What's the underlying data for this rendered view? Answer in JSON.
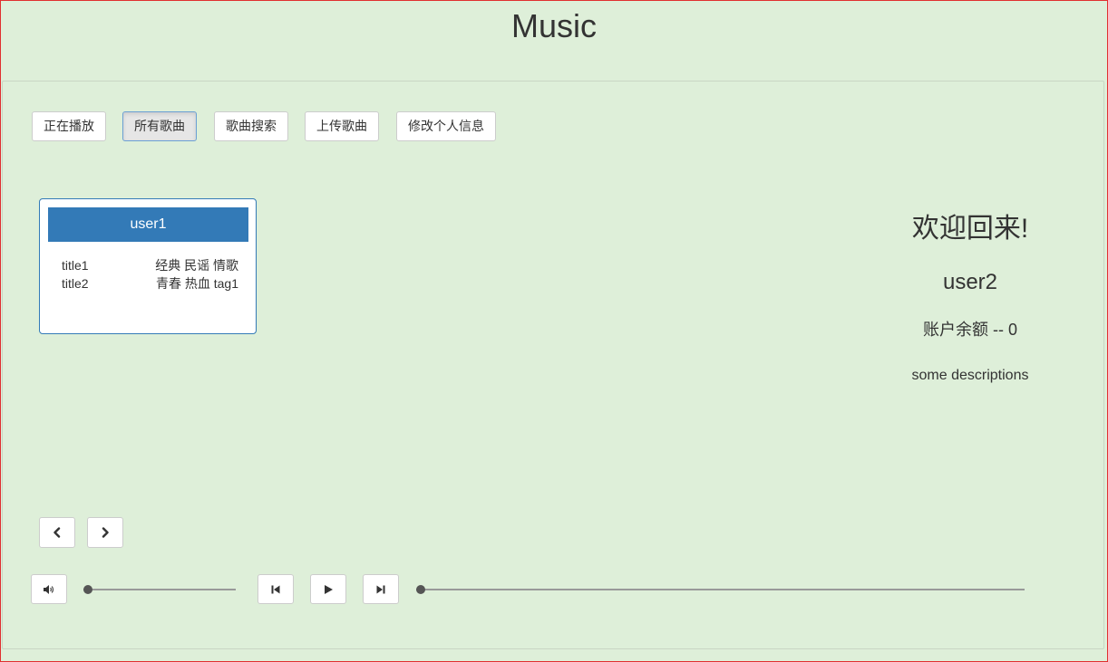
{
  "app": {
    "title": "Music"
  },
  "nav": {
    "buttons": [
      {
        "label": "正在播放",
        "active": false
      },
      {
        "label": "所有歌曲",
        "active": true
      },
      {
        "label": "歌曲搜索",
        "active": false
      },
      {
        "label": "上传歌曲",
        "active": false
      },
      {
        "label": "修改个人信息",
        "active": false
      }
    ]
  },
  "user_card": {
    "username": "user1",
    "songs": [
      {
        "title": "title1",
        "tags": "经典 民谣 情歌"
      },
      {
        "title": "title2",
        "tags": "青春 热血 tag1"
      }
    ]
  },
  "welcome": {
    "heading": "欢迎回来!",
    "username": "user2",
    "balance": "账户余额 -- 0",
    "description": "some descriptions"
  },
  "pager": {
    "prev_icon": "chevron-left-icon",
    "next_icon": "chevron-right-icon"
  },
  "player": {
    "volume_icon": "volume-icon",
    "prev_icon": "skip-previous-icon",
    "play_icon": "play-icon",
    "next_icon": "skip-next-icon",
    "volume_level": 0,
    "progress": 0
  },
  "colors": {
    "background": "#deefd9",
    "primary": "#337ab7",
    "text": "#333333"
  }
}
